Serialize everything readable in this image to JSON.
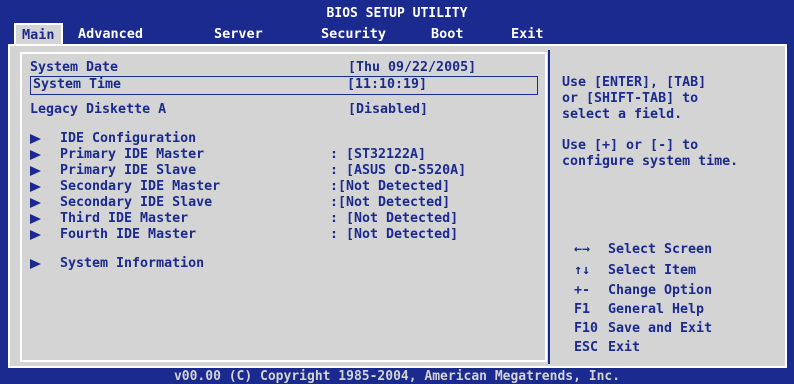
{
  "header": {
    "title": "BIOS SETUP UTILITY",
    "tabs": [
      {
        "label": "Main",
        "active": true
      },
      {
        "label": "Advanced"
      },
      {
        "label": "Server"
      },
      {
        "label": "Security"
      },
      {
        "label": "Boot"
      },
      {
        "label": "Exit"
      }
    ]
  },
  "main": {
    "items": [
      {
        "label": "System Date",
        "value": "[Thu 09/22/2005]"
      },
      {
        "label": "System Time",
        "value": "[11:10:19]",
        "selected": true
      },
      {
        "label": "Legacy Diskette A",
        "value": "[Disabled]"
      },
      {
        "label": "IDE Configuration",
        "value": ""
      },
      {
        "label": "Primary IDE Master",
        "value": ": [ST32122A]"
      },
      {
        "label": "Primary IDE Slave",
        "value": ": [ASUS CD-S520A]"
      },
      {
        "label": "Secondary IDE Master",
        "value": ":[Not Detected]"
      },
      {
        "label": "Secondary IDE Slave",
        "value": ":[Not Detected]"
      },
      {
        "label": "Third IDE Master",
        "value": ": [Not Detected]"
      },
      {
        "label": "Fourth IDE Master",
        "value": ": [Not Detected]"
      },
      {
        "label": "System Information",
        "value": ""
      }
    ]
  },
  "help": {
    "lines": [
      "Use [ENTER], [TAB]",
      "or [SHIFT-TAB] to",
      "select a field.",
      "Use [+]  or [-] to",
      "configure system time."
    ]
  },
  "keys": [
    {
      "key": "←→",
      "desc": "Select Screen"
    },
    {
      "key": "↑↓",
      "desc": "Select Item"
    },
    {
      "key": "+-",
      "desc": "Change Option"
    },
    {
      "key": "F1",
      "desc": "General Help"
    },
    {
      "key": "F10",
      "desc": "Save and Exit"
    },
    {
      "key": "ESC",
      "desc": "Exit"
    }
  ],
  "footer": {
    "text": "v00.00 (C) Copyright 1985-2004, American Megatrends, Inc."
  },
  "colors": {
    "background": "#1a2a8e",
    "panel": "#d4d4d4",
    "text": "#1a2a8e",
    "highlight": "#ffffff"
  }
}
